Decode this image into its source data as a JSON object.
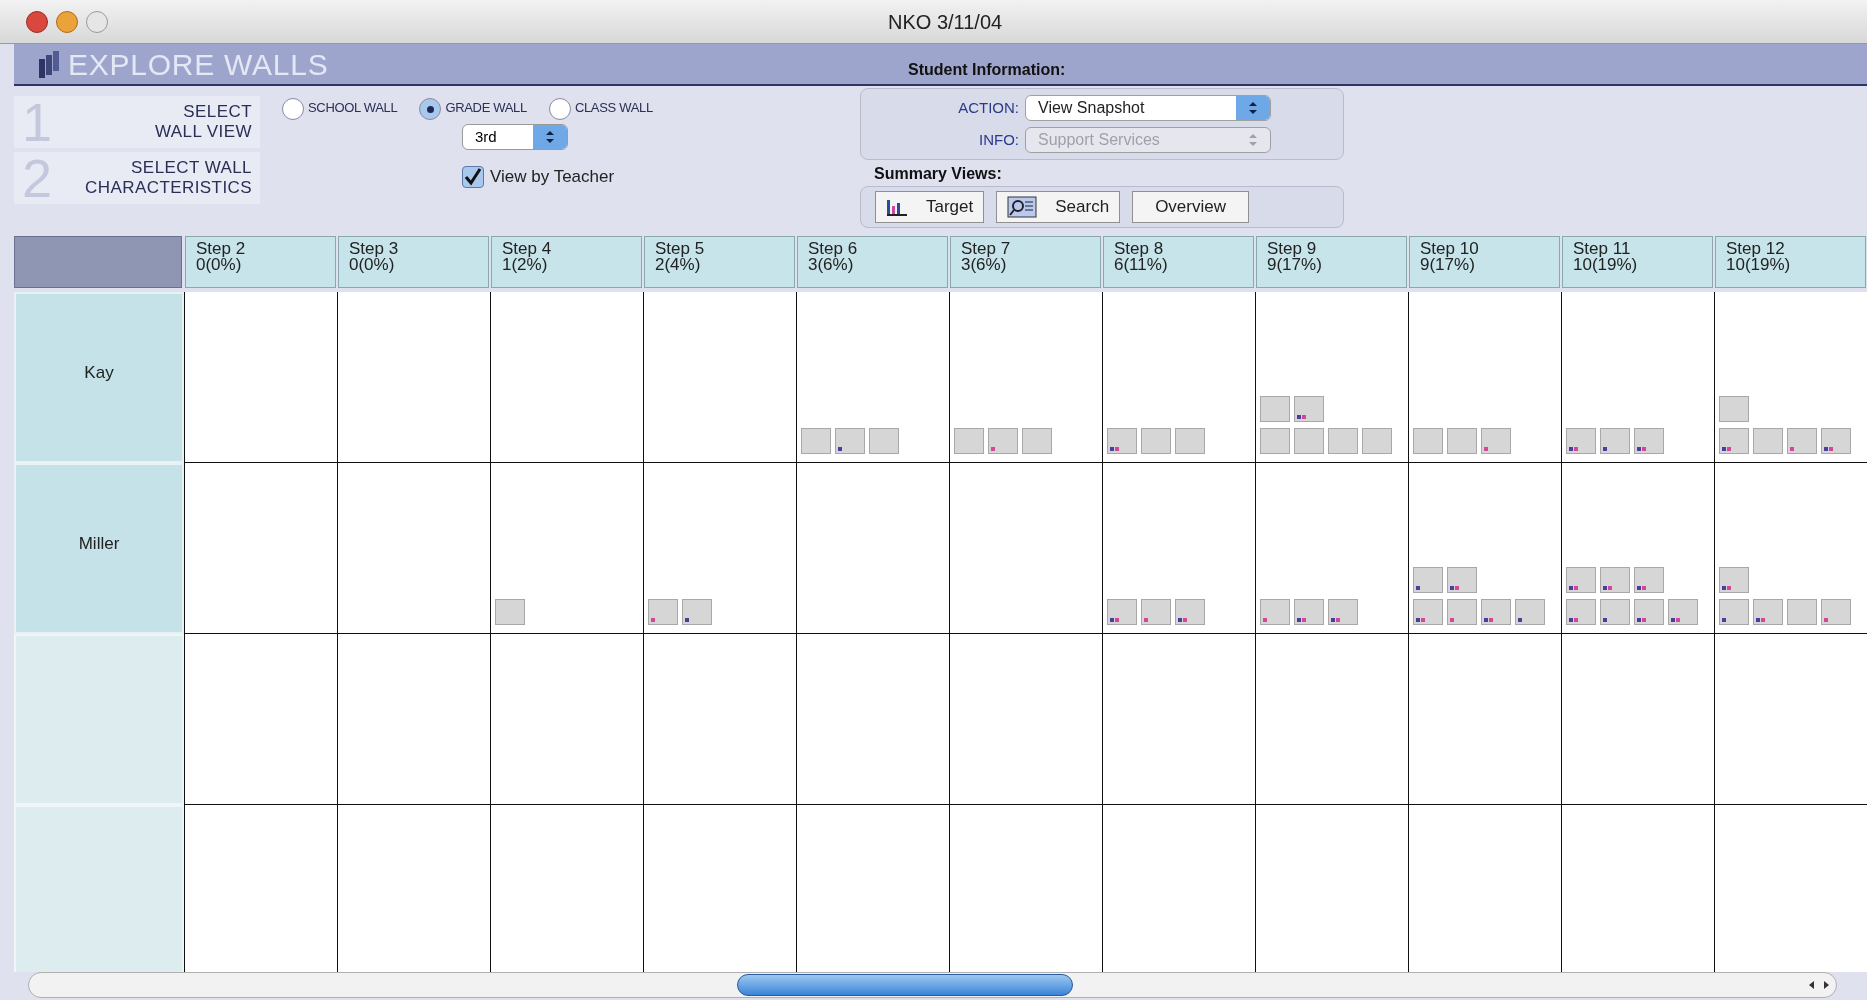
{
  "window": {
    "title": "NKO 3/11/04"
  },
  "app_title": "EXPLORE WALLS",
  "steps": [
    {
      "number": "1",
      "label_lines": [
        "SELECT",
        "WALL VIEW"
      ]
    },
    {
      "number": "2",
      "label_lines": [
        "SELECT WALL",
        "CHARACTERISTICS"
      ]
    }
  ],
  "wall_views": [
    {
      "label": "SCHOOL WALL",
      "selected": false
    },
    {
      "label": "GRADE WALL",
      "selected": true
    },
    {
      "label": "CLASS WALL",
      "selected": false
    }
  ],
  "grade_select": {
    "value": "3rd"
  },
  "view_by_teacher": {
    "label": "View by Teacher",
    "checked": true
  },
  "student_information": {
    "title": "Student Information:",
    "action": {
      "label": "ACTION:",
      "value": "View Snapshot",
      "disabled": false
    },
    "info": {
      "label": "INFO:",
      "value": "Support Services",
      "disabled": true
    }
  },
  "summary_views": {
    "title": "Summary Views:",
    "buttons": [
      {
        "label": "Target",
        "kind": "chart"
      },
      {
        "label": "Search",
        "kind": "search"
      },
      {
        "label": "Overview",
        "kind": "plain"
      }
    ]
  },
  "columns": [
    {
      "step": "Step 2",
      "count": "0(0%)"
    },
    {
      "step": "Step 3",
      "count": "0(0%)"
    },
    {
      "step": "Step 4",
      "count": "1(2%)"
    },
    {
      "step": "Step 5",
      "count": "2(4%)"
    },
    {
      "step": "Step 6",
      "count": "3(6%)"
    },
    {
      "step": "Step 7",
      "count": "3(6%)"
    },
    {
      "step": "Step 8",
      "count": "6(11%)"
    },
    {
      "step": "Step 9",
      "count": "9(17%)"
    },
    {
      "step": "Step 10",
      "count": "9(17%)"
    },
    {
      "step": "Step 11",
      "count": "10(19%)"
    },
    {
      "step": "Step 12",
      "count": "10(19%)"
    }
  ],
  "rows": [
    {
      "kind": "student",
      "name": "Kay",
      "cells": [
        [],
        [],
        [],
        [],
        [
          {
            "blue_dot": false,
            "pink_dot": false
          },
          {
            "blue_dot": true,
            "pink_dot": false
          },
          {
            "blue_dot": false,
            "pink_dot": false
          }
        ],
        [
          {
            "blue_dot": false,
            "pink_dot": false
          },
          {
            "blue_dot": false,
            "pink_dot": true
          },
          {
            "blue_dot": false,
            "pink_dot": false
          }
        ],
        [
          {
            "blue_dot": true,
            "pink_dot": true
          },
          {
            "blue_dot": false,
            "pink_dot": false
          },
          {
            "blue_dot": false,
            "pink_dot": false
          }
        ],
        [
          {
            "blue_dot": false,
            "pink_dot": false
          },
          {
            "blue_dot": false,
            "pink_dot": false
          },
          {
            "blue_dot": false,
            "pink_dot": false
          },
          {
            "blue_dot": false,
            "pink_dot": false
          },
          {
            "blue_dot": false,
            "pink_dot": false
          },
          {
            "blue_dot": true,
            "pink_dot": true
          }
        ],
        [
          {
            "blue_dot": false,
            "pink_dot": false
          },
          {
            "blue_dot": false,
            "pink_dot": false
          },
          {
            "blue_dot": false,
            "pink_dot": true
          }
        ],
        [
          {
            "blue_dot": true,
            "pink_dot": true
          },
          {
            "blue_dot": true,
            "pink_dot": false
          },
          {
            "blue_dot": true,
            "pink_dot": true
          }
        ],
        [
          {
            "blue_dot": true,
            "pink_dot": true
          },
          {
            "blue_dot": false,
            "pink_dot": false
          },
          {
            "blue_dot": false,
            "pink_dot": true
          },
          {
            "blue_dot": true,
            "pink_dot": true
          },
          {
            "blue_dot": false,
            "pink_dot": false
          }
        ]
      ]
    },
    {
      "kind": "student",
      "name": "Miller",
      "cells": [
        [],
        [],
        [
          {
            "blue_dot": false,
            "pink_dot": false
          }
        ],
        [
          {
            "blue_dot": false,
            "pink_dot": true
          },
          {
            "blue_dot": true,
            "pink_dot": false
          }
        ],
        [],
        [],
        [
          {
            "blue_dot": true,
            "pink_dot": true
          },
          {
            "blue_dot": false,
            "pink_dot": true
          },
          {
            "blue_dot": true,
            "pink_dot": true
          }
        ],
        [
          {
            "blue_dot": false,
            "pink_dot": true
          },
          {
            "blue_dot": true,
            "pink_dot": true
          },
          {
            "blue_dot": true,
            "pink_dot": true
          }
        ],
        [
          {
            "blue_dot": true,
            "pink_dot": true
          },
          {
            "blue_dot": false,
            "pink_dot": true
          },
          {
            "blue_dot": true,
            "pink_dot": true
          },
          {
            "blue_dot": true,
            "pink_dot": false
          },
          {
            "blue_dot": true,
            "pink_dot": false
          },
          {
            "blue_dot": true,
            "pink_dot": true
          }
        ],
        [
          {
            "blue_dot": true,
            "pink_dot": true
          },
          {
            "blue_dot": true,
            "pink_dot": false
          },
          {
            "blue_dot": true,
            "pink_dot": true
          },
          {
            "blue_dot": true,
            "pink_dot": true
          },
          {
            "blue_dot": true,
            "pink_dot": true
          },
          {
            "blue_dot": true,
            "pink_dot": true
          },
          {
            "blue_dot": true,
            "pink_dot": true
          }
        ],
        [
          {
            "blue_dot": true,
            "pink_dot": false
          },
          {
            "blue_dot": true,
            "pink_dot": true
          },
          {
            "blue_dot": false,
            "pink_dot": false
          },
          {
            "blue_dot": false,
            "pink_dot": true
          },
          {
            "blue_dot": true,
            "pink_dot": true
          }
        ]
      ]
    },
    {
      "kind": "blank"
    },
    {
      "kind": "blank"
    }
  ]
}
